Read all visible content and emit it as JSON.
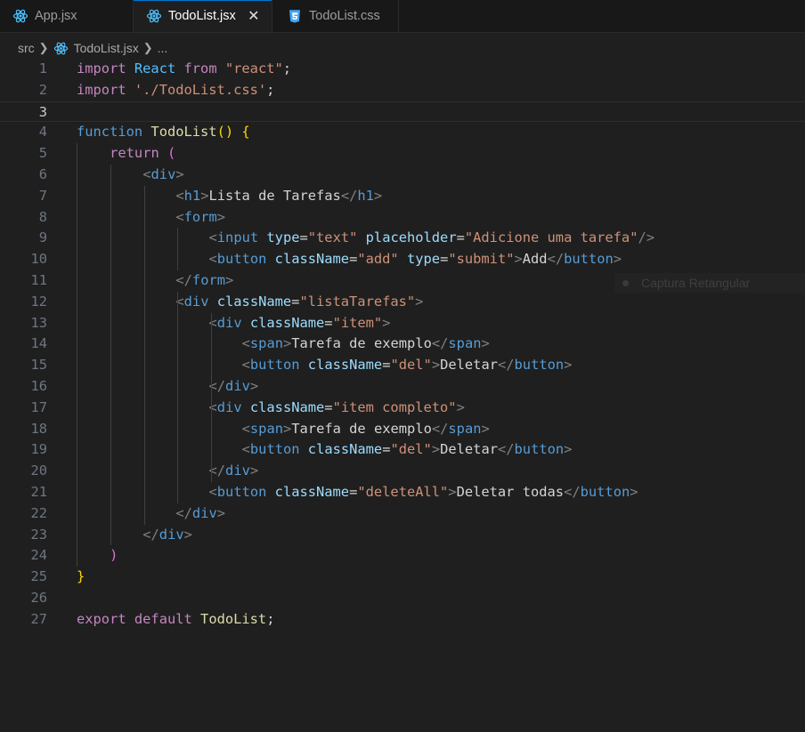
{
  "tabs": [
    {
      "label": "App.jsx",
      "icon": "react-icon",
      "active": false
    },
    {
      "label": "TodoList.jsx",
      "icon": "react-icon",
      "active": true
    },
    {
      "label": "TodoList.css",
      "icon": "css-icon",
      "active": false
    }
  ],
  "tab_close_glyph": "✕",
  "breadcrumb": {
    "folder": "src",
    "file": "TodoList.jsx",
    "more": "..."
  },
  "current_line": 3,
  "colors": {
    "keyword": "#569cd6",
    "control": "#c586c0",
    "string": "#ce9178",
    "function": "#dcdcaa",
    "attribute": "#9cdcfe",
    "variable": "#4fc1ff",
    "react_icon": "#4fc1ff",
    "css_icon": "#42a5f5"
  },
  "code_lines": [
    "import React from \"react\";",
    "import './TodoList.css';",
    "",
    "function TodoList() {",
    "    return (",
    "        <div>",
    "            <h1>Lista de Tarefas</h1>",
    "            <form>",
    "                <input type=\"text\" placeholder=\"Adicione uma tarefa\"/>",
    "                <button className=\"add\" type=\"submit\">Add</button>",
    "            </form>",
    "            <div className=\"listaTarefas\">",
    "                <div className=\"item\">",
    "                    <span>Tarefa de exemplo</span>",
    "                    <button className=\"del\">Deletar</button>",
    "                </div>",
    "                <div className=\"item completo\">",
    "                    <span>Tarefa de exemplo</span>",
    "                    <button className=\"del\">Deletar</button>",
    "                </div>",
    "                <button className=\"deleteAll\">Deletar todas</button>",
    "            </div>",
    "        </div>",
    "    )",
    "}",
    "",
    "export default TodoList;"
  ],
  "overlay_label": "Captura Retangular"
}
